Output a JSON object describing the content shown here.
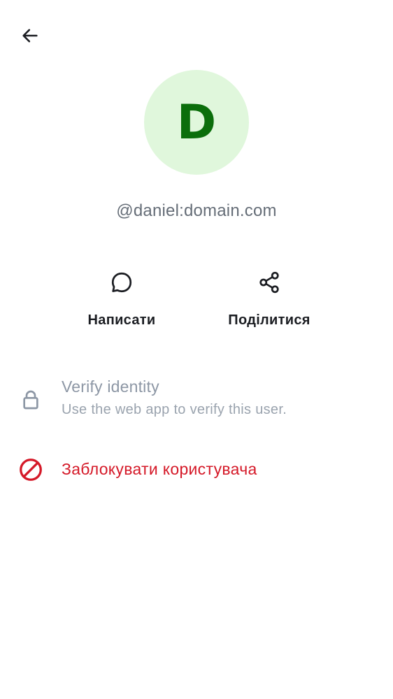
{
  "header": {
    "back_icon": "arrow-left-icon"
  },
  "profile": {
    "avatar_initial": "D",
    "avatar_bg_color": "#e0f7dc",
    "avatar_fg_color": "#0b6e0b",
    "user_id": "@daniel:domain.com"
  },
  "actions": {
    "message": {
      "icon": "chat-bubble-icon",
      "label": "Написати"
    },
    "share": {
      "icon": "share-icon",
      "label": "Поділитися"
    }
  },
  "verify": {
    "icon": "lock-icon",
    "title": "Verify identity",
    "subtitle": "Use the web app to verify this user."
  },
  "block": {
    "icon": "block-icon",
    "label": "Заблокувати користувача",
    "color": "#d51928"
  }
}
